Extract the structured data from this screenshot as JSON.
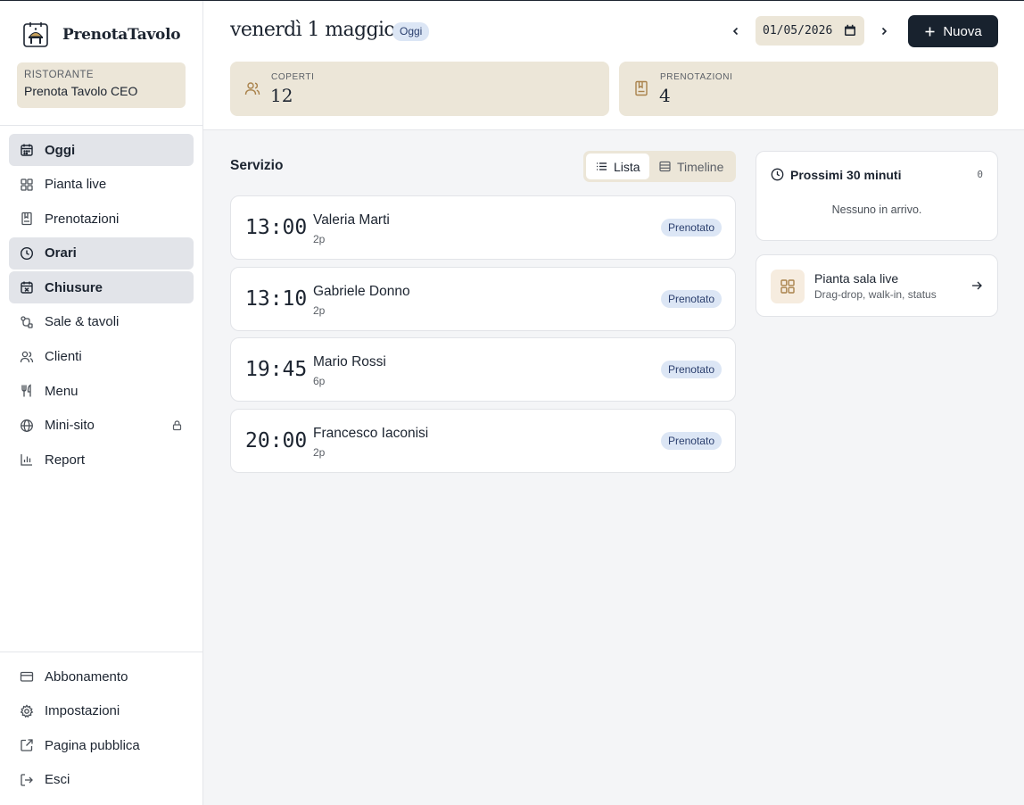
{
  "app": {
    "name": "PrenotaTavolo"
  },
  "restaurant": {
    "label": "RISTORANTE",
    "name": "Prenota Tavolo CEO"
  },
  "sidebar": {
    "items": [
      {
        "label": "Oggi",
        "icon": "calendar-icon",
        "active": true
      },
      {
        "label": "Pianta live",
        "icon": "grid-icon",
        "active": false
      },
      {
        "label": "Prenotazioni",
        "icon": "bookmark-icon",
        "active": false
      },
      {
        "label": "Orari",
        "icon": "clock-icon",
        "active": true
      },
      {
        "label": "Chiusure",
        "icon": "calendar-x-icon",
        "active": true
      },
      {
        "label": "Sale & tavoli",
        "icon": "route-icon",
        "active": false
      },
      {
        "label": "Clienti",
        "icon": "users-icon",
        "active": false
      },
      {
        "label": "Menu",
        "icon": "utensils-icon",
        "active": false
      },
      {
        "label": "Mini-sito",
        "icon": "globe-icon",
        "active": false,
        "locked": true
      },
      {
        "label": "Report",
        "icon": "bar-chart-icon",
        "active": false
      }
    ],
    "bottom_items": [
      {
        "label": "Abbonamento",
        "icon": "credit-card-icon"
      },
      {
        "label": "Impostazioni",
        "icon": "gear-icon"
      },
      {
        "label": "Pagina pubblica",
        "icon": "external-link-icon"
      },
      {
        "label": "Esci",
        "icon": "logout-icon"
      }
    ]
  },
  "header": {
    "date_title": "venerdì 1 maggio",
    "today_badge": "Oggi",
    "date_value": "01/05/2026",
    "new_button": "Nuova"
  },
  "stats": [
    {
      "label": "COPERTI",
      "value": "12",
      "icon": "users-icon"
    },
    {
      "label": "PRENOTAZIONI",
      "value": "4",
      "icon": "book-icon"
    }
  ],
  "service": {
    "title": "Servizio",
    "view_list": "Lista",
    "view_timeline": "Timeline",
    "active_view": "Lista"
  },
  "reservations": [
    {
      "time": "13:00",
      "name": "Valeria Marti",
      "covers": "2p",
      "status": "Prenotato"
    },
    {
      "time": "13:10",
      "name": "Gabriele Donno",
      "covers": "2p",
      "status": "Prenotato"
    },
    {
      "time": "19:45",
      "name": "Mario Rossi",
      "covers": "6p",
      "status": "Prenotato"
    },
    {
      "time": "20:00",
      "name": "Francesco Iaconisi",
      "covers": "2p",
      "status": "Prenotato"
    }
  ],
  "next30": {
    "title": "Prossimi 30 minuti",
    "count": "0",
    "empty": "Nessuno in arrivo."
  },
  "map_link": {
    "title": "Pianta sala live",
    "subtitle": "Drag-drop, walk-in, status"
  },
  "colors": {
    "accent_dark": "#18222e",
    "beige": "#ece6d8",
    "badge_blue": "#dce6f5",
    "icon_brown": "#a9824b"
  }
}
